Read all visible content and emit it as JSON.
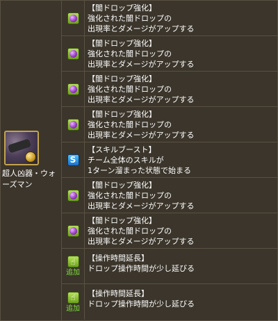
{
  "monster": {
    "name": "超人凶器・ウォーズマン"
  },
  "colors": {
    "badge_green": "#8cc43a",
    "badge_blue": "#2a8ee0",
    "add_label": "#7fe03a"
  },
  "awakenings": [
    {
      "icon": "dark-drop-enhance-icon",
      "badge": "green",
      "title": "【闇ドロップ強化】",
      "lines": [
        "強化された闇ドロップの",
        "出現率とダメージがアップする"
      ]
    },
    {
      "icon": "dark-drop-enhance-icon",
      "badge": "green",
      "title": "【闇ドロップ強化】",
      "lines": [
        "強化された闇ドロップの",
        "出現率とダメージがアップする"
      ]
    },
    {
      "icon": "dark-drop-enhance-icon",
      "badge": "green",
      "title": "【闇ドロップ強化】",
      "lines": [
        "強化された闇ドロップの",
        "出現率とダメージがアップする"
      ]
    },
    {
      "icon": "dark-drop-enhance-icon",
      "badge": "green",
      "title": "【闇ドロップ強化】",
      "lines": [
        "強化された闇ドロップの",
        "出現率とダメージがアップする"
      ]
    },
    {
      "icon": "skill-boost-icon",
      "badge": "blue",
      "title": "【スキルブースト】",
      "lines": [
        "チーム全体のスキルが",
        "1ターン溜まった状態で始まる"
      ]
    },
    {
      "icon": "dark-drop-enhance-icon",
      "badge": "green",
      "title": "【闇ドロップ強化】",
      "lines": [
        "強化された闇ドロップの",
        "出現率とダメージがアップする"
      ]
    },
    {
      "icon": "dark-drop-enhance-icon",
      "badge": "green",
      "title": "【闇ドロップ強化】",
      "lines": [
        "強化された闇ドロップの",
        "出現率とダメージがアップする"
      ]
    },
    {
      "icon": "time-extend-icon",
      "badge": "green",
      "added": "追加",
      "title": "【操作時間延長】",
      "lines": [
        "ドロップ操作時間が少し延びる"
      ]
    },
    {
      "icon": "time-extend-icon",
      "badge": "green",
      "added": "追加",
      "title": "【操作時間延長】",
      "lines": [
        "ドロップ操作時間が少し延びる"
      ]
    }
  ]
}
